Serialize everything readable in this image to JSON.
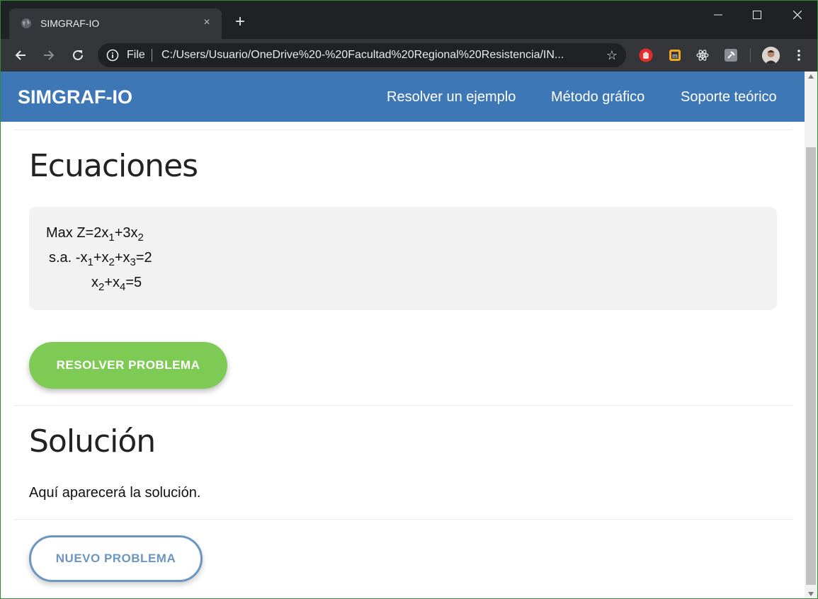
{
  "browser": {
    "tab_title": "SIMGRAF-IO",
    "tab_close": "×",
    "new_tab": "+",
    "scheme_label": "File",
    "url": "C:/Users/Usuario/OneDrive%20-%20Facultad%20Regional%20Resistencia/IN...",
    "star": "☆",
    "icons": {
      "tab": "globe-icon",
      "back": "back-arrow-icon",
      "forward": "forward-arrow-icon",
      "reload": "reload-icon",
      "info": "info-icon",
      "extensions": [
        "hand-stop-extension-icon",
        "m-extension-icon",
        "react-extension-icon",
        "pin-extension-icon"
      ],
      "profile": "avatar",
      "menu": "kebab-menu-icon"
    }
  },
  "app": {
    "brand": "SIMGRAF-IO",
    "nav": [
      "Resolver un ejemplo",
      "Método gráfico",
      "Soporte teórico"
    ],
    "colors": {
      "header": "#3e77b6",
      "resolve_button": "#7dcb55",
      "new_button": "#6c95c2"
    }
  },
  "ecuaciones": {
    "heading": "Ecuaciones",
    "line1": {
      "prefix": "Max  Z=2x",
      "s1": "1",
      "mid": "+3x",
      "s2": "2"
    },
    "line2": {
      "prefix": "s.a. -x",
      "s1": "1",
      "a": "+x",
      "s2": "2",
      "b": "+x",
      "s3": "3",
      "end": "=2"
    },
    "line3": {
      "prefix": "x",
      "s1": "2",
      "a": "+x",
      "s2": "4",
      "end": "=5"
    }
  },
  "buttons": {
    "resolver": "RESOLVER PROBLEMA",
    "nuevo": "NUEVO PROBLEMA"
  },
  "solucion": {
    "heading": "Solución",
    "text": "Aquí aparecerá la solución."
  }
}
